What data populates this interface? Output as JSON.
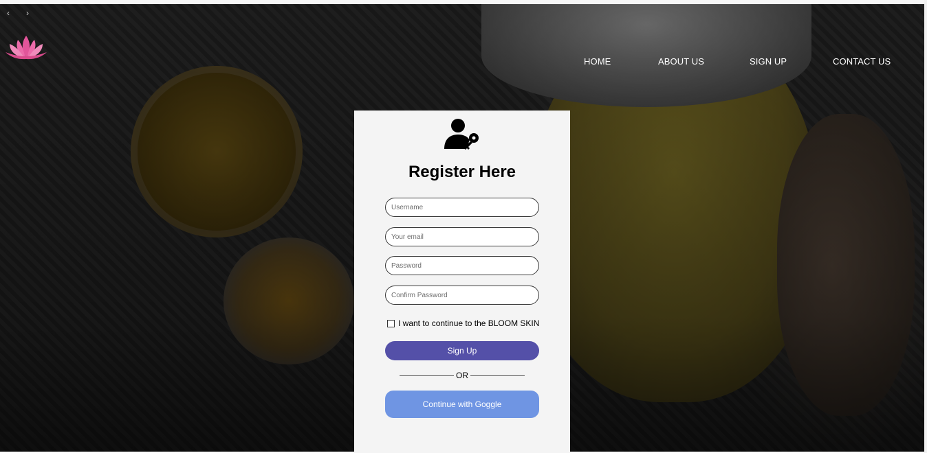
{
  "carousel": {
    "prev_glyph": "‹",
    "next_glyph": "›"
  },
  "logo": {
    "icon": "lotus-icon",
    "color": "#e2559a"
  },
  "nav": {
    "items": [
      {
        "label": "HOME"
      },
      {
        "label": "ABOUT US"
      },
      {
        "label": "SIGN UP"
      },
      {
        "label": "CONTACT US"
      }
    ]
  },
  "register": {
    "icon": "user-key-icon",
    "title": "Register Here",
    "username_placeholder": "Username",
    "email_placeholder": "Your email",
    "password_placeholder": "Password",
    "confirm_placeholder": "Confirm Password",
    "checkbox_label": "I want to continue to the BLOOM SKIN",
    "signup_label": "Sign Up",
    "or_label": "OR",
    "google_label": "Continue with Goggle"
  },
  "colors": {
    "signup_button": "#5450a8",
    "google_button": "#6f95e3",
    "card_background": "#f4f4f4"
  }
}
